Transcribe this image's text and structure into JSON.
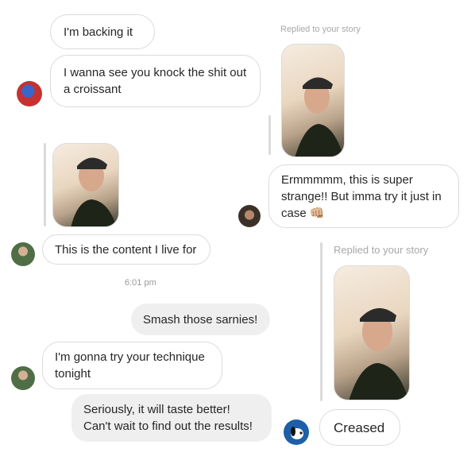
{
  "left_col": {
    "msg1": "I'm backing it",
    "msg2": "I wanna see you knock the shit out a croissant",
    "msg3": "This is the content I live for",
    "msg4": "I'm gonna try your technique tonight"
  },
  "right_col": {
    "reply_label_1": "Replied to your story",
    "msg1": "Ermmmmm, this is super strange!! But imma try it just in case 👊🏼",
    "reply_label_2": "Replied to your story",
    "msg2": "Creased"
  },
  "center": {
    "timestamp": "6:01 pm",
    "sent1": "Smash those sarnies!",
    "sent2": "Seriously, it will taste better! Can't wait to find out the results!"
  },
  "icons": {
    "avatar_1": "red-superhero-avatar",
    "avatar_2": "man-avatar",
    "avatar_3": "green-person-avatar",
    "avatar_4": "snoopy-avatar"
  }
}
